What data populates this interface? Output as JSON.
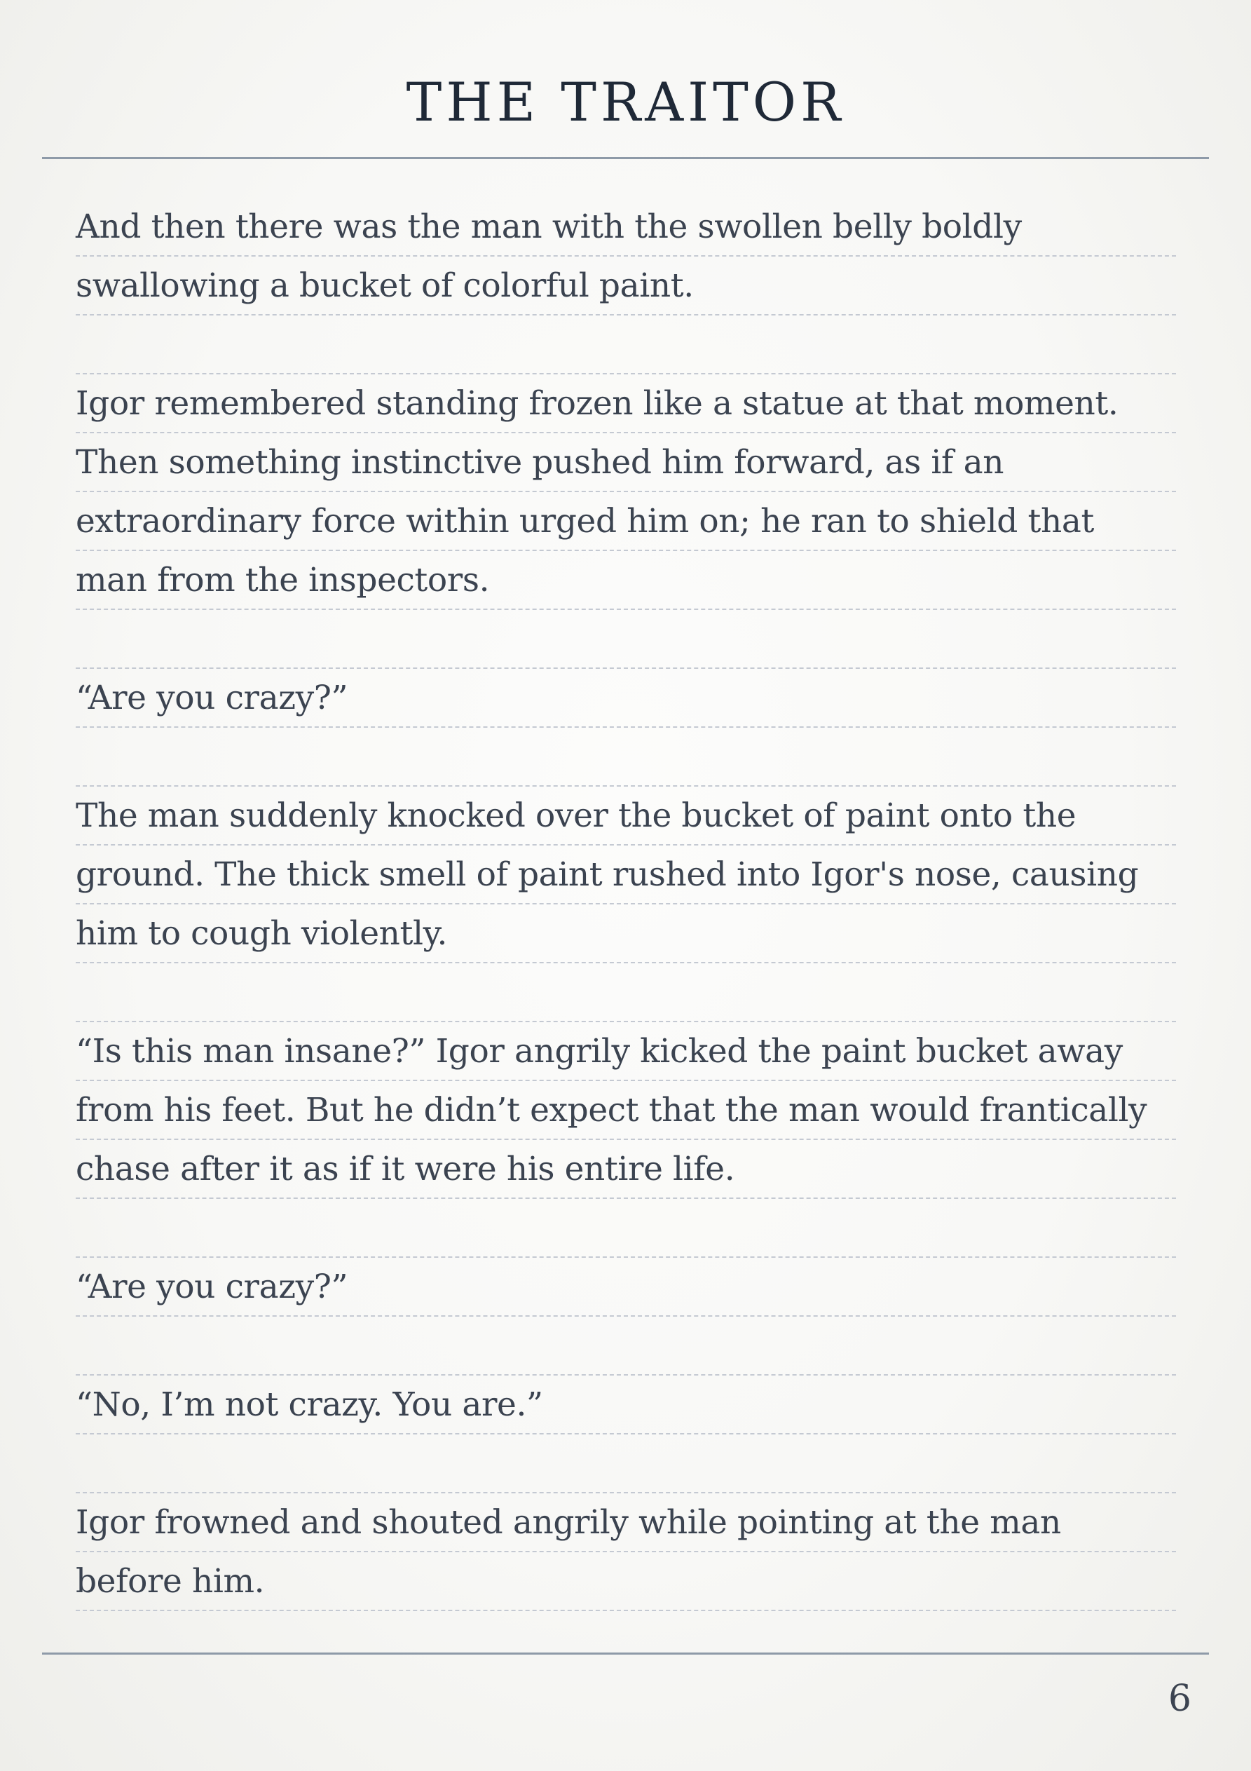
{
  "title": "THE TRAITOR",
  "lines": [
    "And then there was the man with the swollen belly boldly",
    "swallowing a bucket of colorful paint.",
    "",
    "Igor remembered standing frozen like a statue at that moment.",
    "Then something instinctive pushed him forward, as if an",
    "extraordinary force within urged him on; he ran to shield that",
    "man from the inspectors.",
    "",
    "“Are you crazy?”",
    "",
    "The man suddenly knocked over the bucket of paint onto the",
    "ground. The thick smell of paint rushed into Igor's nose, causing",
    "him to cough violently.",
    "",
    "“Is this man insane?” Igor angrily kicked the paint bucket away",
    "from his feet. But he didn’t expect that the man would frantically",
    "chase after it as if it were his entire life.",
    "",
    "“Are you crazy?”",
    "",
    "“No, I’m not crazy. You are.”",
    "",
    "Igor frowned and shouted angrily while pointing at the man",
    "before him."
  ],
  "page_number": "6"
}
